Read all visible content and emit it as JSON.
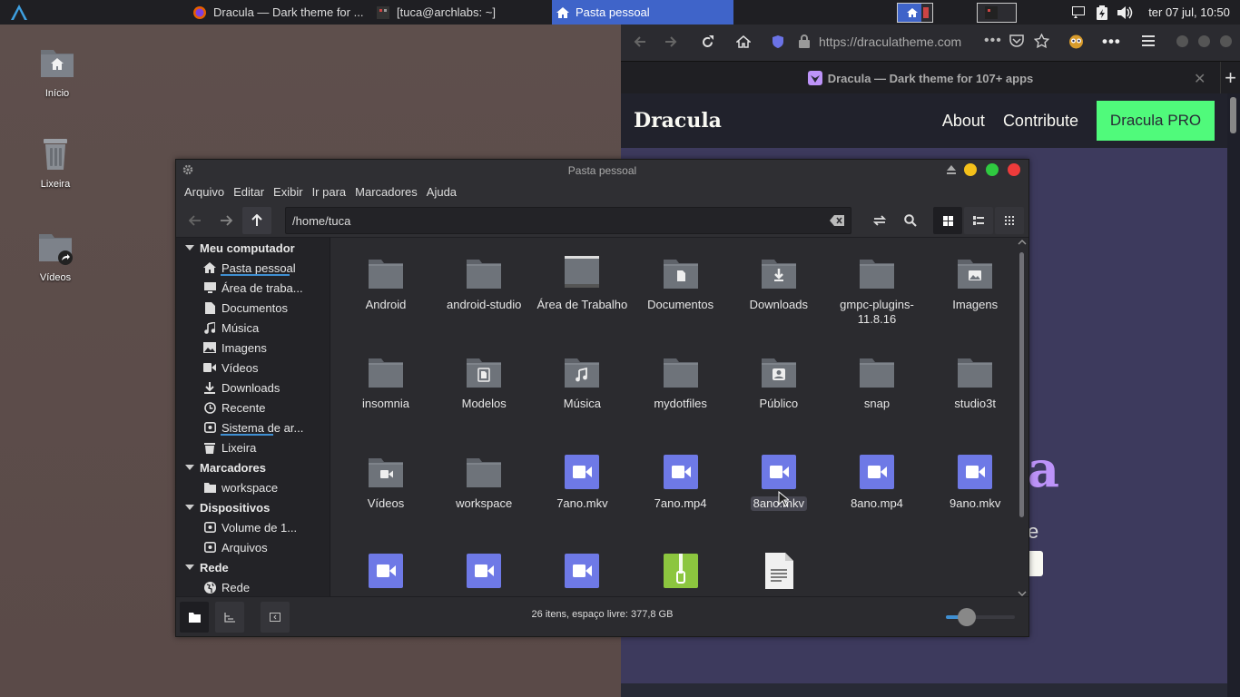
{
  "panel": {
    "tasks": [
      {
        "label": "Dracula — Dark theme for ..."
      },
      {
        "label": "[tuca@archlabs: ~]"
      },
      {
        "label": "Pasta pessoal"
      }
    ],
    "clock": "ter 07 jul, 10:50"
  },
  "desktop": {
    "icons": [
      {
        "label": "Início"
      },
      {
        "label": "Lixeira"
      },
      {
        "label": "Vídeos"
      }
    ]
  },
  "firefox": {
    "url": "https://draculatheme.com",
    "tab_title": "Dracula — Dark theme for 107+ apps",
    "site_logo": "Dracula",
    "nav": [
      "About",
      "Contribute"
    ],
    "pro_button": "Dracula PRO",
    "hero_fragments": {
      "big_letter": "a",
      "small_letter": "e"
    }
  },
  "nemo": {
    "title": "Pasta pessoal",
    "menu": [
      "Arquivo",
      "Editar",
      "Exibir",
      "Ir para",
      "Marcadores",
      "Ajuda"
    ],
    "path": "/home/tuca",
    "sidebar": {
      "sections": [
        {
          "title": "Meu computador",
          "items": [
            {
              "label": "Pasta pessoal",
              "icon": "home-icon"
            },
            {
              "label": "Área de traba...",
              "icon": "desktop-icon"
            },
            {
              "label": "Documentos",
              "icon": "document-icon"
            },
            {
              "label": "Música",
              "icon": "music-icon"
            },
            {
              "label": "Imagens",
              "icon": "image-icon"
            },
            {
              "label": "Vídeos",
              "icon": "video-icon"
            },
            {
              "label": "Downloads",
              "icon": "download-icon"
            },
            {
              "label": "Recente",
              "icon": "clock-icon"
            },
            {
              "label": "Sistema de ar...",
              "icon": "drive-icon"
            },
            {
              "label": "Lixeira",
              "icon": "trash-icon"
            }
          ]
        },
        {
          "title": "Marcadores",
          "items": [
            {
              "label": "workspace",
              "icon": "folder-icon"
            }
          ]
        },
        {
          "title": "Dispositivos",
          "items": [
            {
              "label": "Volume de 1...",
              "icon": "drive-icon"
            },
            {
              "label": "Arquivos",
              "icon": "drive-icon"
            }
          ]
        },
        {
          "title": "Rede",
          "items": [
            {
              "label": "Rede",
              "icon": "network-icon"
            }
          ]
        }
      ]
    },
    "files": [
      {
        "name": "Android",
        "kind": "folder"
      },
      {
        "name": "android-studio",
        "kind": "folder"
      },
      {
        "name": "Área de Trabalho",
        "kind": "desktop-folder"
      },
      {
        "name": "Documentos",
        "kind": "documents-folder"
      },
      {
        "name": "Downloads",
        "kind": "downloads-folder"
      },
      {
        "name": "gmpc-plugins-11.8.16",
        "kind": "folder"
      },
      {
        "name": "Imagens",
        "kind": "pictures-folder"
      },
      {
        "name": "insomnia",
        "kind": "folder"
      },
      {
        "name": "Modelos",
        "kind": "templates-folder"
      },
      {
        "name": "Música",
        "kind": "music-folder"
      },
      {
        "name": "mydotfiles",
        "kind": "folder"
      },
      {
        "name": "Público",
        "kind": "public-folder"
      },
      {
        "name": "snap",
        "kind": "folder"
      },
      {
        "name": "studio3t",
        "kind": "folder"
      },
      {
        "name": "Vídeos",
        "kind": "videos-folder"
      },
      {
        "name": "workspace",
        "kind": "folder"
      },
      {
        "name": "7ano.mkv",
        "kind": "video"
      },
      {
        "name": "7ano.mp4",
        "kind": "video"
      },
      {
        "name": "8ano.mkv",
        "kind": "video",
        "selected": true
      },
      {
        "name": "8ano.mp4",
        "kind": "video"
      },
      {
        "name": "9ano.mkv",
        "kind": "video"
      },
      {
        "name": "",
        "kind": "video"
      },
      {
        "name": "",
        "kind": "video"
      },
      {
        "name": "",
        "kind": "video"
      },
      {
        "name": "",
        "kind": "archive"
      },
      {
        "name": "",
        "kind": "text"
      }
    ],
    "status": "26 itens, espaço livre: 377,8 GB",
    "zoom_level": 0.3
  },
  "colors": {
    "accent": "#3f64c9",
    "dracula_green": "#50fa7b",
    "folder": "#6c7077",
    "video": "#6e79e6",
    "archive": "#8cc63f"
  }
}
